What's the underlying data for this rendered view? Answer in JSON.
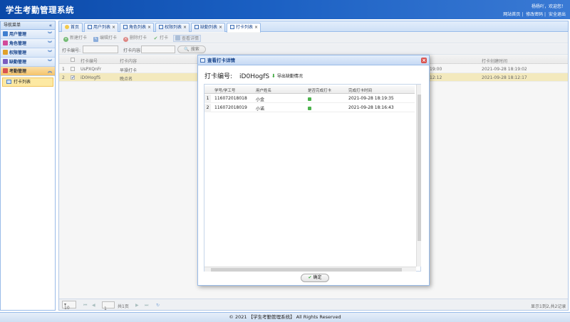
{
  "app": {
    "title": "学生考勤管理系统",
    "welcome": "杨杨吖，欢迎您！",
    "links": [
      "网站首页",
      "修改密码",
      "安全退出"
    ]
  },
  "sidebar": {
    "header": "导航菜单",
    "collapse": "«",
    "items": [
      {
        "label": "用户管理",
        "icon": "users-icon",
        "color": "#3f7fd0"
      },
      {
        "label": "角色管理",
        "icon": "roles-icon",
        "color": "#d24a9a"
      },
      {
        "label": "权限管理",
        "icon": "key-icon",
        "color": "#e0a12a"
      },
      {
        "label": "缺勤管理",
        "icon": "absence-icon",
        "color": "#7a5cc0"
      },
      {
        "label": "考勤管理",
        "icon": "attendance-icon",
        "color": "#d9534f"
      }
    ],
    "sub_item": "打卡列表"
  },
  "tabs": [
    {
      "label": "首页"
    },
    {
      "label": "用户列表"
    },
    {
      "label": "角色列表"
    },
    {
      "label": "权限列表"
    },
    {
      "label": "缺勤列表"
    },
    {
      "label": "打卡列表"
    }
  ],
  "toolbar": {
    "new": "新建打卡",
    "edit": "编辑打卡",
    "delete": "删除打卡",
    "checkin": "打卡",
    "detail": "查看详情"
  },
  "search": {
    "code_label": "打卡编号:",
    "content_label": "打卡内容:",
    "button": "搜索"
  },
  "grid": {
    "headers": [
      "打卡编号",
      "打卡内容",
      "打卡创建时间"
    ],
    "rows": [
      {
        "num": "1",
        "code": "UsPXQnFr",
        "content": "早操打卡",
        "time_partial": "19:00",
        "created": "2021-09-28 18:19:02"
      },
      {
        "num": "2",
        "code": "iD0HogfS",
        "content": "晚点名",
        "time_partial": "12:12",
        "created": "2021-09-28 18:12:17"
      }
    ]
  },
  "pager": {
    "page_size": "10",
    "page": "1",
    "total_pages": "共1页",
    "summary": "显示1到2,共2记录"
  },
  "footer": "© 2021 【学生考勤管理系统】 All Rights Reserved",
  "dialog": {
    "title": "查看打卡详情",
    "code_label": "打卡编号:",
    "code_value": "iD0HogfS",
    "export": "导出缺勤情况",
    "headers": [
      "学号/学工号",
      "用户姓名",
      "是否完成打卡",
      "完成打卡时间"
    ],
    "rows": [
      {
        "num": "1",
        "sid": "116072018018",
        "name": "小金",
        "time": "2021-09-28 18:19:35"
      },
      {
        "num": "2",
        "sid": "116072018019",
        "name": "小诺",
        "time": "2021-09-28 18:16:43"
      }
    ],
    "ok": "确定"
  }
}
